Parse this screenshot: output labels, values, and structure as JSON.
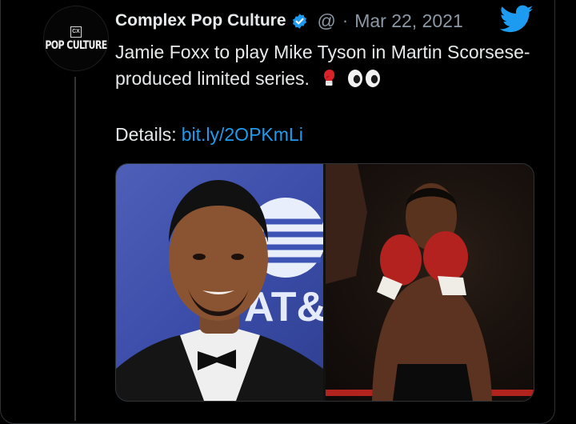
{
  "tweet": {
    "author": "Complex Pop Culture",
    "handle": "@",
    "separator": "·",
    "date": "Mar 22, 2021",
    "text": "Jamie Foxx to play Mike Tyson in Martin Scorsese-produced limited series.",
    "details_label": "Details:",
    "link": "bit.ly/2OPKmLi",
    "avatar_text": "POP CULTURE",
    "avatar_mark": "CX"
  },
  "media": {
    "left_logo_text": "AT&"
  },
  "colors": {
    "background": "#000000",
    "text": "#e7e9ea",
    "muted": "#8b98a5",
    "link": "#1d9bf0",
    "twitter_blue": "#1d9bf0",
    "att_blue": "#3a4ca8"
  },
  "icons": {
    "verified": "verified-badge-icon",
    "bird": "twitter-bird-icon",
    "glove": "boxing-glove-emoji",
    "eyes": "eyes-emoji"
  }
}
